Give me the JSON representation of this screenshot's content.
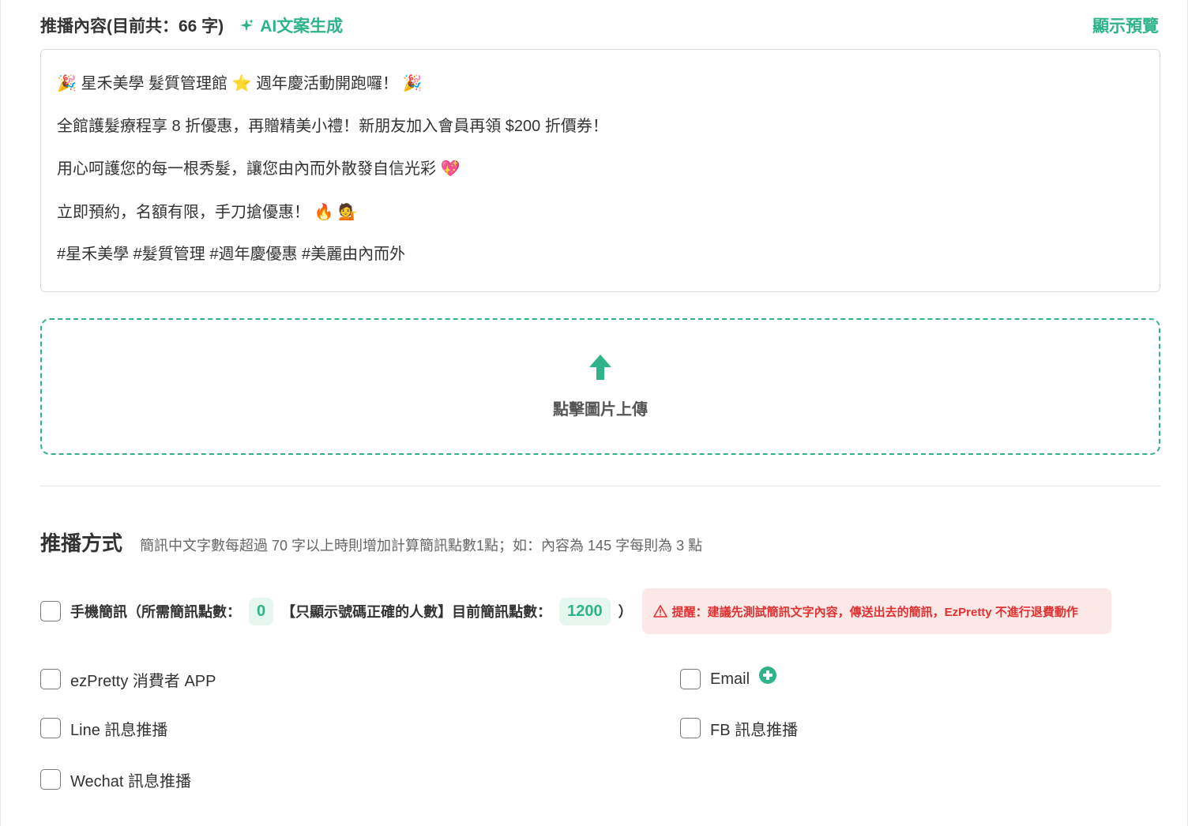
{
  "header": {
    "title": "推播內容(目前共：66 字)",
    "ai_button": "AI文案生成",
    "preview_link": "顯示預覽"
  },
  "content": {
    "line1_text_a": "星禾美學 髮質管理館",
    "line1_text_b": "週年慶活動開跑囉！",
    "line2": "全館護髮療程享 8 折優惠，再贈精美小禮！新朋友加入會員再領 $200 折價券！",
    "line3": "用心呵護您的每一根秀髮，讓您由內而外散發自信光彩",
    "line4": "立即預約，名額有限，手刀搶優惠！",
    "line5": "#星禾美學 #髮質管理 #週年慶優惠 #美麗由內而外"
  },
  "upload": {
    "label": "點擊圖片上傳"
  },
  "method": {
    "title": "推播方式",
    "note": "簡訊中文字數每超過 70 字以上時則增加計算簡訊點數1點；如：內容為 145 字每則為 3 點"
  },
  "sms": {
    "label_a": "手機簡訊（所需簡訊點數：",
    "required_points": "0",
    "label_b": "【只顯示號碼正確的人數】目前簡訊點數：",
    "current_points": "1200",
    "label_c": "）",
    "warning": "提醒：建議先測試簡訊文字內容，傳送出去的簡訊，EzPretty 不進行退費動作"
  },
  "options": {
    "app": "ezPretty 消費者 APP",
    "email": "Email",
    "line": "Line 訊息推播",
    "fb": "FB 訊息推播",
    "wechat": "Wechat 訊息推播"
  },
  "colors": {
    "accent": "#2fb38a",
    "warning_bg": "#fde8e8",
    "warning_text": "#e03131"
  }
}
